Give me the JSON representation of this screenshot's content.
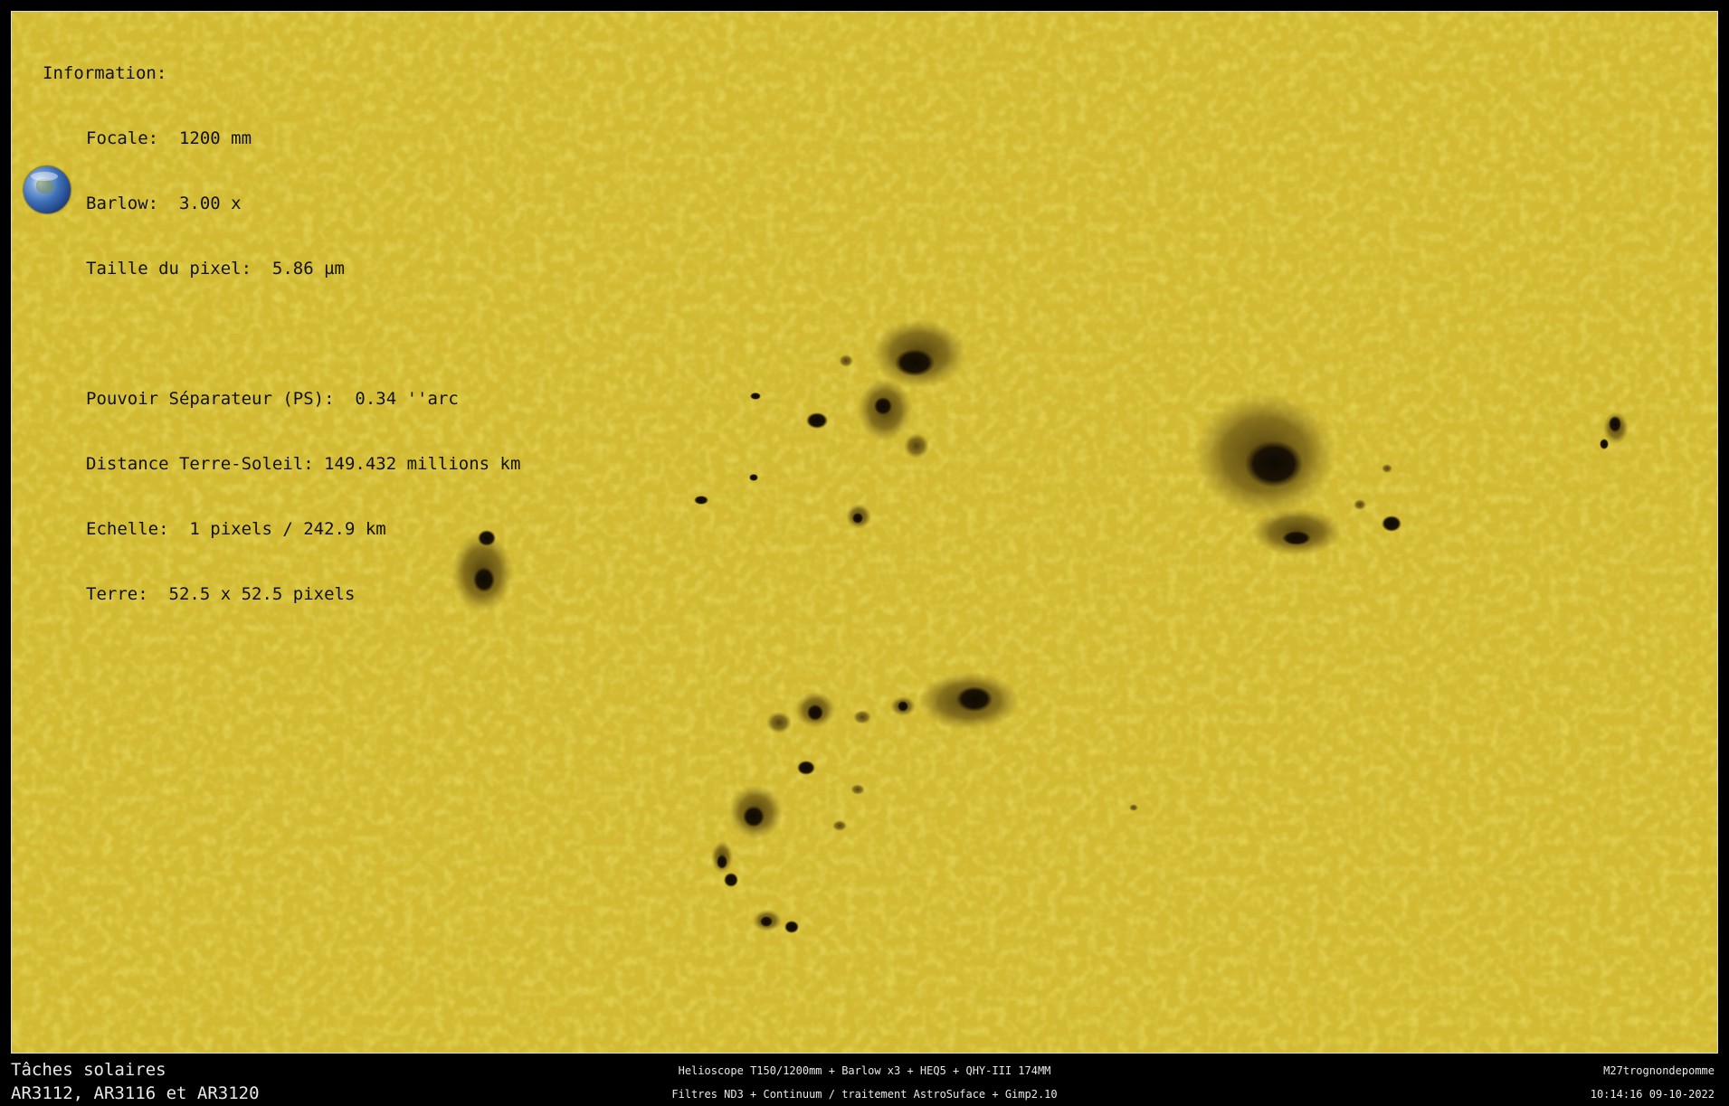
{
  "info": {
    "heading": "Information:",
    "focale": "Focale:  1200 mm",
    "barlow": "Barlow:  3.00 x",
    "pixel": "Taille du pixel:  5.86 µm",
    "ps": "Pouvoir Séparateur (PS):  0.34 ''arc",
    "distance": "Distance Terre-Soleil: 149.432 millions km",
    "echelle": "Echelle:  1 pixels / 242.9 km",
    "terre": "Terre:  52.5 x 52.5 pixels"
  },
  "footer": {
    "title_line1": "Tâches solaires",
    "title_line2": "AR3112, AR3116 et AR3120",
    "equipment_line1": "Helioscope T150/1200mm + Barlow x3 + HEQ5 + QHY-III 174MM",
    "equipment_line2": "Filtres ND3 + Continuum / traitement AstroSuface + Gimp2.10",
    "author": "M27trognondepomme",
    "datetime": "10:14:16 09-10-2022"
  },
  "colors": {
    "photosphere": "#c6ae2a",
    "umbra": "#1a1204",
    "penumbra": "#6b5612",
    "frame_border": "#d8d8d8",
    "background": "#000000"
  }
}
